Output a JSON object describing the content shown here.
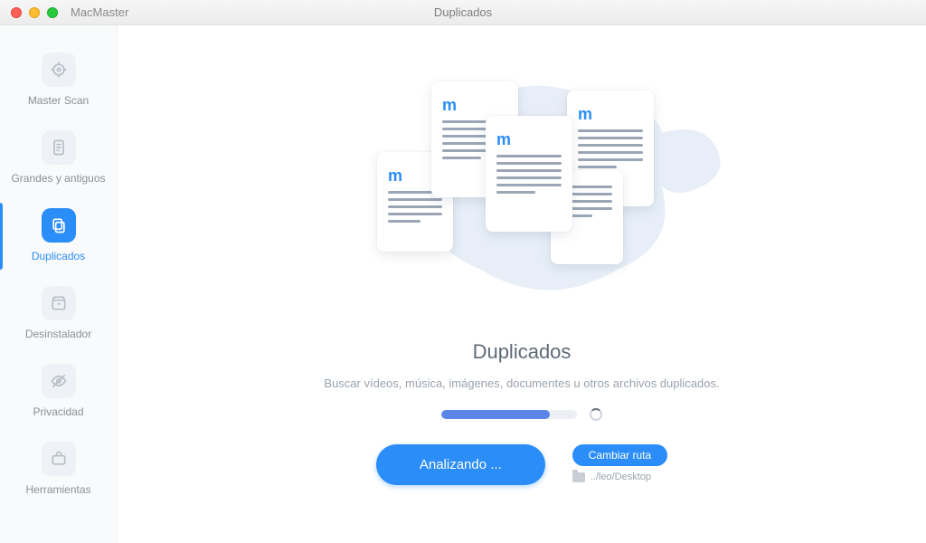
{
  "app_name": "MacMaster",
  "window_title": "Duplicados",
  "sidebar": {
    "items": [
      {
        "label": "Master Scan"
      },
      {
        "label": "Grandes y antiguos"
      },
      {
        "label": "Duplicados"
      },
      {
        "label": "Desinstalador"
      },
      {
        "label": "Privacidad"
      },
      {
        "label": "Herramientas"
      }
    ]
  },
  "main": {
    "heading": "Duplicados",
    "description": "Buscar vídeos, música, imágenes, documentes u otros archivos duplicados.",
    "progress_percent": 80,
    "analyze_button": "Analizando ...",
    "change_path_button": "Cambiar ruta",
    "current_path": "../leo/Desktop"
  }
}
